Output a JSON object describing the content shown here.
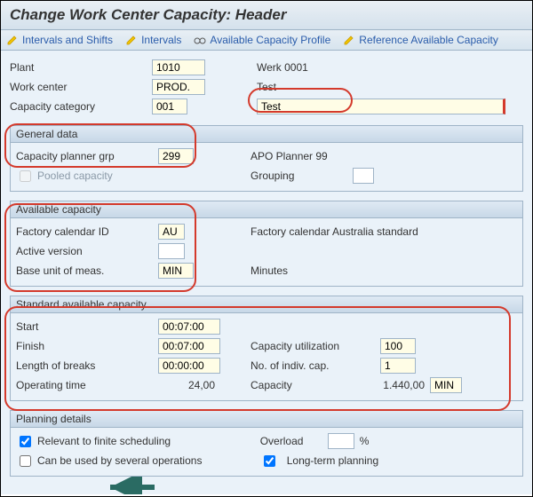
{
  "title": "Change Work Center Capacity: Header",
  "toolbar": {
    "intervals_shifts": "Intervals and Shifts",
    "intervals": "Intervals",
    "avail_profile": "Available Capacity Profile",
    "ref_avail": "Reference Available Capacity"
  },
  "top": {
    "plant_label": "Plant",
    "plant_value": "1010",
    "plant_desc": "Werk 0001",
    "workcenter_label": "Work center",
    "workcenter_value": "PROD.",
    "workcenter_desc": "Test",
    "capcat_label": "Capacity category",
    "capcat_value": "001",
    "capcat_desc": "Test"
  },
  "general": {
    "header": "General data",
    "planner_label": "Capacity planner grp",
    "planner_value": "299",
    "planner_desc": "APO Planner 99",
    "pooled_label": "Pooled capacity",
    "grouping_label": "Grouping",
    "grouping_value": ""
  },
  "available": {
    "header": "Available capacity",
    "cal_label": "Factory calendar ID",
    "cal_value": "AU",
    "cal_desc": "Factory calendar Australia standard",
    "active_label": "Active version",
    "active_value": "",
    "uom_label": "Base unit of meas.",
    "uom_value": "MIN",
    "uom_desc": "Minutes"
  },
  "standard": {
    "header": "Standard available capacity",
    "start_label": "Start",
    "start_value": "00:07:00",
    "finish_label": "Finish",
    "finish_value": "00:07:00",
    "breaks_label": "Length of breaks",
    "breaks_value": "00:00:00",
    "optime_label": "Operating time",
    "optime_value": "24,00",
    "util_label": "Capacity utilization",
    "util_value": "100",
    "indiv_label": "No. of indiv. cap.",
    "indiv_value": "1",
    "cap_label": "Capacity",
    "cap_value": "1.440,00",
    "cap_unit": "MIN"
  },
  "planning": {
    "header": "Planning details",
    "finite_label": "Relevant to finite scheduling",
    "finite_checked": true,
    "overload_label": "Overload",
    "overload_value": "",
    "overload_unit": "%",
    "several_label": "Can be used by several operations",
    "longterm_label": "Long-term planning",
    "longterm_checked": true
  }
}
